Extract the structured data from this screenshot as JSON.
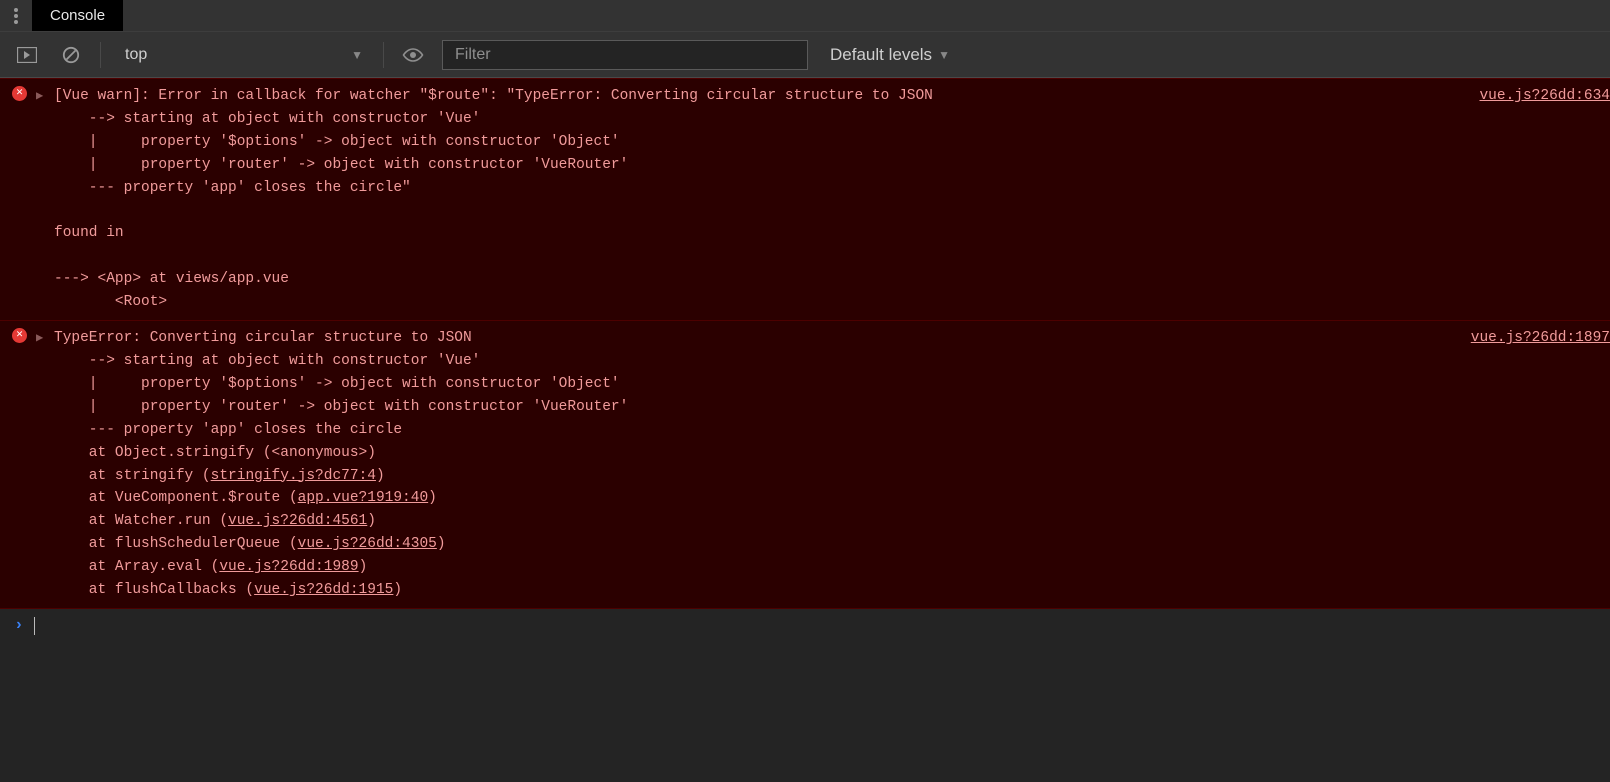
{
  "tabs": {
    "active": "Console"
  },
  "toolbar": {
    "context_label": "top",
    "filter_placeholder": "Filter",
    "levels_label": "Default levels"
  },
  "messages": [
    {
      "type": "error",
      "source": "vue.js?26dd:634",
      "lines": [
        "[Vue warn]: Error in callback for watcher \"$route\": \"TypeError: Converting circular structure to JSON",
        "    --> starting at object with constructor 'Vue'",
        "    |     property '$options' -> object with constructor 'Object'",
        "    |     property 'router' -> object with constructor 'VueRouter'",
        "    --- property 'app' closes the circle\"",
        "",
        "found in",
        "",
        "---> <App> at views/app.vue",
        "       <Root>"
      ],
      "link_lines": []
    },
    {
      "type": "error",
      "source": "vue.js?26dd:1897",
      "lines": [
        "TypeError: Converting circular structure to JSON",
        "    --> starting at object with constructor 'Vue'",
        "    |     property '$options' -> object with constructor 'Object'",
        "    |     property 'router' -> object with constructor 'VueRouter'",
        "    --- property 'app' closes the circle",
        "    at Object.stringify (<anonymous>)"
      ],
      "stack_links": [
        {
          "prefix": "    at stringify (",
          "link": "stringify.js?dc77:4",
          "suffix": ")"
        },
        {
          "prefix": "    at VueComponent.$route (",
          "link": "app.vue?1919:40",
          "suffix": ")"
        },
        {
          "prefix": "    at Watcher.run (",
          "link": "vue.js?26dd:4561",
          "suffix": ")"
        },
        {
          "prefix": "    at flushSchedulerQueue (",
          "link": "vue.js?26dd:4305",
          "suffix": ")"
        },
        {
          "prefix": "    at Array.eval (",
          "link": "vue.js?26dd:1989",
          "suffix": ")"
        },
        {
          "prefix": "    at flushCallbacks (",
          "link": "vue.js?26dd:1915",
          "suffix": ")"
        }
      ]
    }
  ],
  "prompt": {
    "symbol": "›"
  }
}
